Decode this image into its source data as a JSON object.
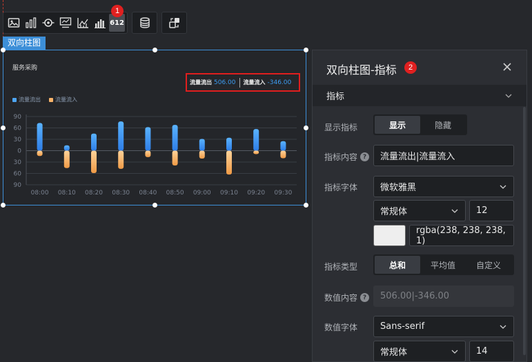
{
  "toolbar": {
    "icons": [
      "image-icon",
      "bar-chart-icon",
      "ring-icon",
      "stat-card-icon",
      "axis-chart-icon",
      "bar-chart-small-icon",
      "number-icon",
      "database-icon",
      "shape-swap-icon"
    ],
    "number_icon_label": "612",
    "step_badge": "1"
  },
  "component_tag": "双向柱图",
  "widget": {
    "title": "服务采购",
    "kpi": [
      {
        "label": "流量流出",
        "value": "506.00"
      },
      {
        "label": "流量流入",
        "value": "-346.00"
      }
    ]
  },
  "chart_data": {
    "type": "bar",
    "categories": [
      "08:00",
      "08:10",
      "08:20",
      "08:30",
      "08:40",
      "08:50",
      "09:00",
      "09:10",
      "09:20",
      "09:30"
    ],
    "series": [
      {
        "name": "流量流出",
        "values": [
          73,
          14,
          45,
          77,
          62,
          68,
          31,
          34,
          57,
          25
        ],
        "color": "#4ea6f5"
      },
      {
        "name": "流量流入",
        "values": [
          -14,
          -46,
          -59,
          -48,
          -17,
          -39,
          -21,
          -63,
          -9,
          -20
        ],
        "color": "#f7b36a"
      }
    ],
    "y_tick_labels": [
      "90",
      "60",
      "30",
      "0",
      "30",
      "60",
      "90"
    ],
    "ylim": [
      -90,
      90
    ],
    "grid": true,
    "legend_placement": "top-left"
  },
  "panel": {
    "title": "双向柱图-指标",
    "step_badge": "2",
    "section": "指标",
    "show_label": "显示指标",
    "show_options": [
      "显示",
      "隐藏"
    ],
    "content_label": "指标内容",
    "content_value": "流量流出|流量流入",
    "font_label": "指标字体",
    "font_family": "微软雅黑",
    "font_weight": "常规体",
    "font_size": "12",
    "font_color": "rgba(238, 238, 238, 1)",
    "type_label": "指标类型",
    "type_options": [
      "总和",
      "平均值",
      "自定义"
    ],
    "value_content_label": "数值内容",
    "value_content": "506.00|-346.00",
    "value_font_label": "数值字体",
    "value_font_family": "Sans-serif",
    "value_font_weight": "常规体",
    "value_font_size": "14",
    "colors": {
      "accent": "#3d8fd8",
      "highlight": "#e01e1e",
      "out": "#4ea6f5",
      "in": "#f7b36a"
    }
  }
}
